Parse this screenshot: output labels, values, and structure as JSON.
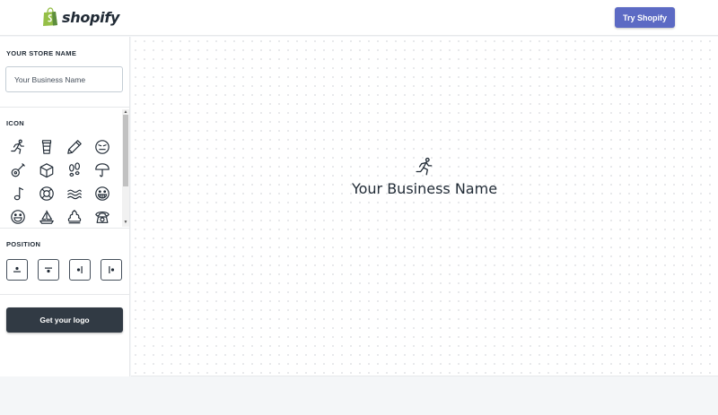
{
  "header": {
    "brand": "shopify",
    "brand_icon": "shopping-bag-icon",
    "cta_label": "Try Shopify",
    "cta_color": "#5c6ac4"
  },
  "sidebar": {
    "store_section_title": "YOUR STORE NAME",
    "store_name_value": "Your Business Name",
    "icon_section_title": "ICON",
    "icons": [
      "runner-icon",
      "coffee-cup-icon",
      "pencil-icon",
      "emoji-face-icon",
      "guitar-icon",
      "box-icon",
      "footprints-icon",
      "umbrella-icon",
      "music-note-icon",
      "lifebuoy-icon",
      "waves-icon",
      "grinning-face-icon",
      "smiley-face-icon",
      "sailboat-icon",
      "ice-cream-icon",
      "rotary-phone-icon"
    ],
    "position_section_title": "POSITION",
    "position_options": [
      "icon-top-text-bottom",
      "icon-bottom-text-top",
      "icon-right",
      "icon-left"
    ],
    "submit_label": "Get your logo",
    "submit_color": "#313a44"
  },
  "preview": {
    "icon": "runner-icon",
    "business_name": "Your Business Name"
  }
}
